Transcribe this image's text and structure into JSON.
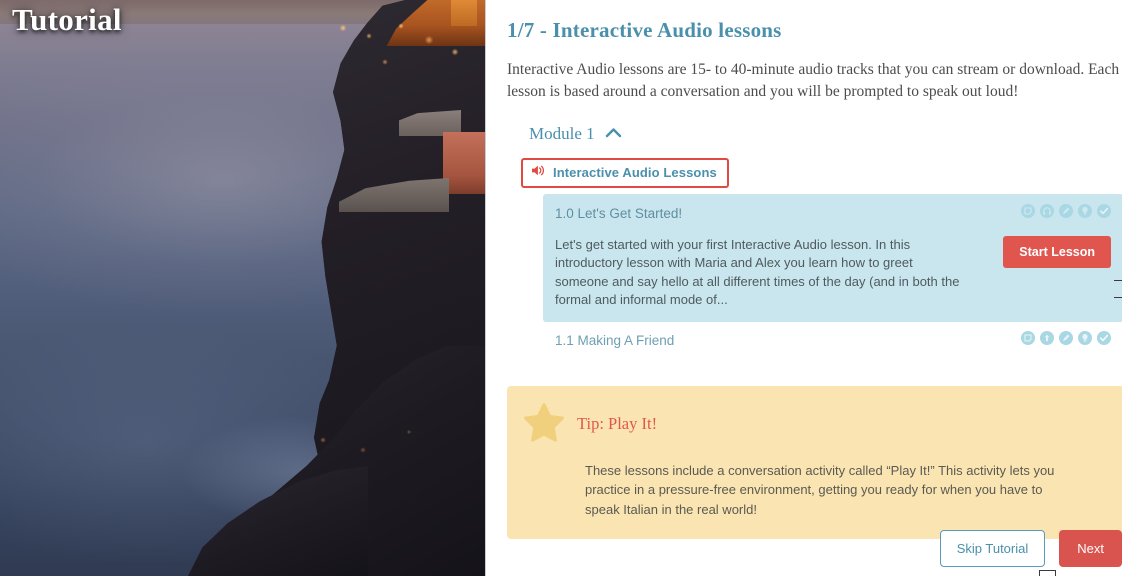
{
  "photo": {
    "overlay_title": "Tutorial",
    "scene_description": "twilight-coastal-village-photo"
  },
  "slide": {
    "title": "1/7 - Interactive Audio lessons",
    "description": "Interactive Audio lessons are 15- to 40-minute audio tracks that you can stream or download. Each lesson is based around a conversation and you will be prompted to speak out loud!"
  },
  "module": {
    "label": "Module 1",
    "collapse_icon": "chevron-up-icon",
    "category": {
      "icon": "speaker-volume-icon",
      "label": "Interactive Audio Lessons",
      "highlight_color": "#e04a43"
    },
    "lessons": [
      {
        "number_title": "1.0 Let's Get Started!",
        "body": "Let's get started with your first Interactive Audio lesson.  In this introductory lesson with Maria and Alex you learn how to greet someone and say hello at all different times of the day (and in both the formal and informal mode of...",
        "action_label": "Start Lesson",
        "expanded": true,
        "icons": [
          "flashcard-icon",
          "headphones-icon",
          "pencil-icon",
          "lightbulb-icon",
          "check-circle-icon"
        ]
      },
      {
        "number_title": "1.1 Making A Friend",
        "body": "",
        "action_label": "",
        "expanded": false,
        "icons": [
          "flashcard-icon",
          "upload-icon",
          "pencil-icon",
          "lightbulb-icon",
          "check-circle-icon"
        ]
      }
    ]
  },
  "tip": {
    "icon": "star-icon",
    "title": "Tip: Play It!",
    "text": "These lessons include a conversation activity called “Play It!” This activity lets you practice in a pressure-free environment, getting you ready for when you have to speak Italian in the real world!"
  },
  "footer": {
    "skip_label": "Skip Tutorial",
    "next_label": "Next"
  },
  "colors": {
    "accent_teal": "#4a90ac",
    "accent_red": "#d9534f",
    "card_blue": "#c9e6ee",
    "tip_yellow": "#fae5b2"
  }
}
